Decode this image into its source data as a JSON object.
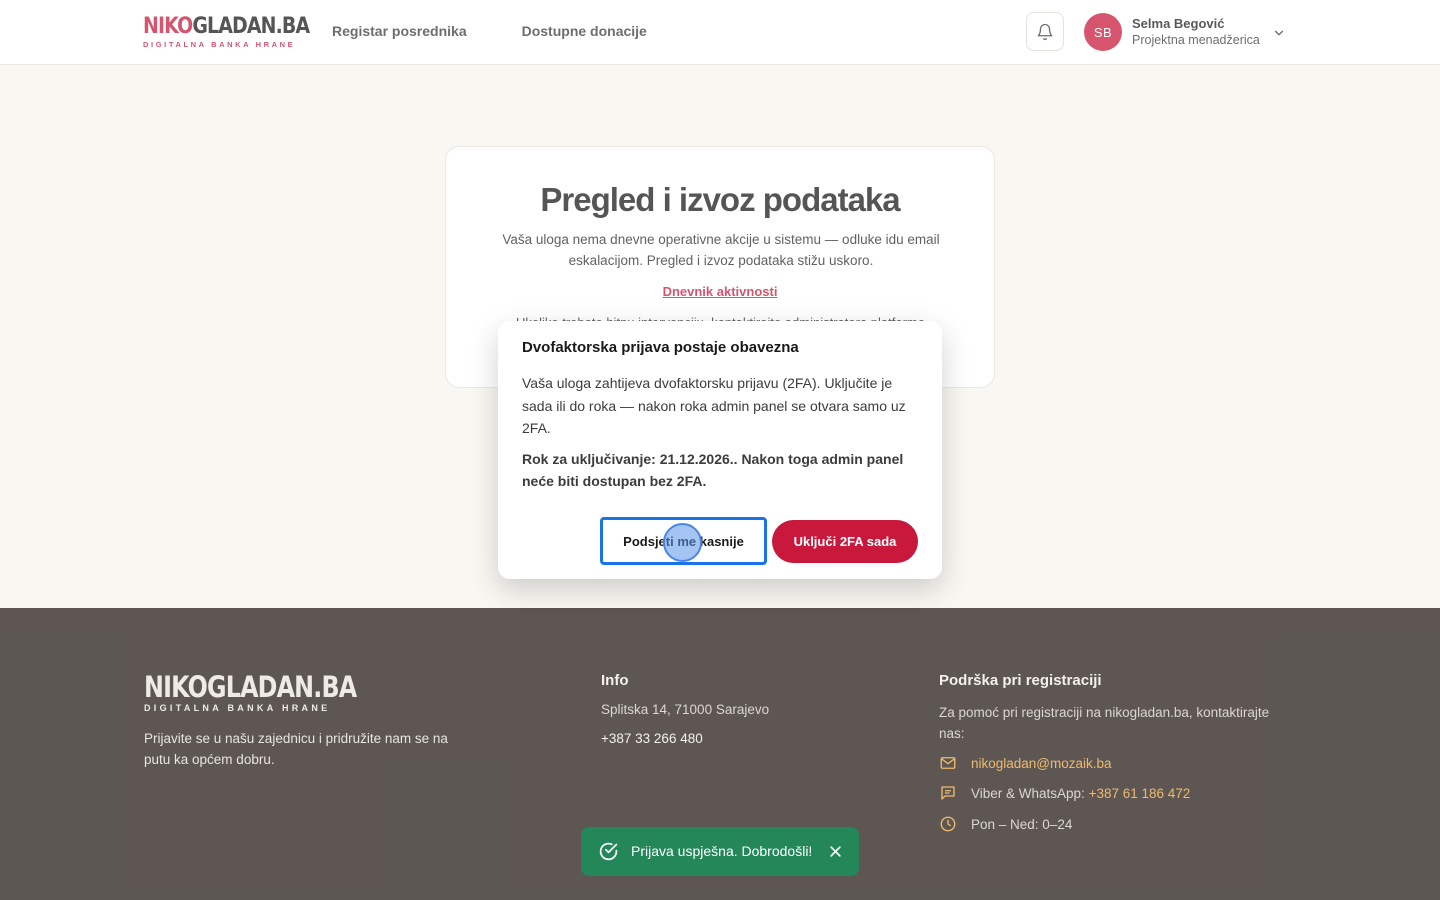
{
  "header": {
    "logo_main_red": "NIKO",
    "logo_main_dark": "GLADAN.BA",
    "logo_sub": "DIGITALNA BANKA HRANE",
    "nav": [
      "Registar posrednika",
      "Dostupne donacije"
    ],
    "user": {
      "initials": "SB",
      "name": "Selma Begović",
      "role": "Projektna menadžerica"
    }
  },
  "card": {
    "title": "Pregled i izvoz podataka",
    "description": "Vaša uloga nema dnevne operativne akcije u sistemu — odluke idu email eskalacijom. Pregled i izvoz podataka stižu uskoro.",
    "link": "Dnevnik aktivnosti",
    "more": "Ukoliko trebate hitnu intervenciju, kontaktirajte administratora platforme."
  },
  "modal": {
    "title": "Dvofaktorska prijava postaje obavezna",
    "body": "Vaša uloga zahtijeva dvofaktorsku prijavu (2FA). Uključite je sada ili do roka — nakon roka admin panel se otvara samo uz 2FA.",
    "deadline": "Rok za uključivanje: 21.12.2026.. Nakon toga admin panel neće biti dostupan bez 2FA.",
    "remind_later": "Podsjeti me kasnije",
    "enable_now": "Uključi 2FA sada"
  },
  "footer": {
    "logo_main": "NIKOGLADAN.BA",
    "logo_sub": "DIGITALNA BANKA HRANE",
    "about": "Prijavite se u našu zajednicu i pridružite nam se na putu ka općem dobru.",
    "info_heading": "Info",
    "address": "Splitska 14, 71000 Sarajevo",
    "phone": "+387 33 266 480",
    "support_heading": "Podrška pri registraciji",
    "support_text": "Za pomoć pri registraciji na nikogladan.ba, kontaktirajte nas:",
    "email": "nikogladan@mozaik.ba",
    "viber_label": "Viber & WhatsApp: ",
    "viber_number": "+387 61 186 472",
    "hours": "Pon – Ned: 0–24"
  },
  "toast": {
    "message": "Prijava uspješna. Dobrodošli!"
  },
  "colors": {
    "brand": "#c8193c",
    "accent": "#e8a33a",
    "footer_bg": "#251c18",
    "success": "#23875a",
    "focus": "#1a73e8"
  }
}
